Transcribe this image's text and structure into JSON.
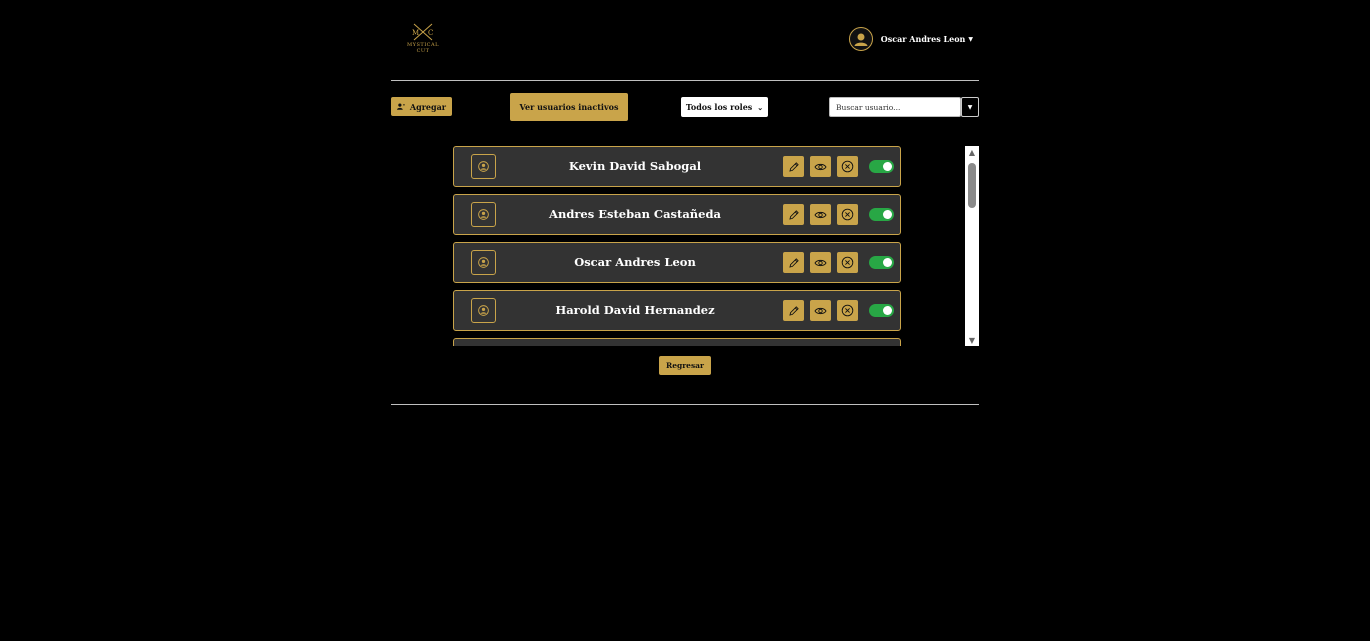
{
  "brand": {
    "logo_letters": "M C",
    "logo_text_1": "MYSTICAL",
    "logo_text_2": "CUT"
  },
  "user_menu": {
    "name": "Oscar Andres Leon"
  },
  "toolbar": {
    "add_label": "Agregar",
    "inactive_label": "Ver usuarios inactivos",
    "roles_selected": "Todos los roles",
    "search_placeholder": "Buscar usuario..."
  },
  "users": [
    {
      "name": "Kevin David Sabogal",
      "active": true
    },
    {
      "name": "Andres Esteban Castañeda",
      "active": true
    },
    {
      "name": "Oscar Andres Leon",
      "active": true
    },
    {
      "name": "Harold David Hernandez",
      "active": true
    }
  ],
  "footer": {
    "back_label": "Regresar"
  },
  "colors": {
    "accent": "#c9a44a",
    "card_bg": "#333333",
    "toggle_on": "#28a745",
    "background": "#000000"
  },
  "icons": {
    "add_user": "user-plus-icon",
    "user": "user-circle-icon",
    "edit": "pencil-icon",
    "view": "eye-icon",
    "delete": "x-circle-icon"
  }
}
